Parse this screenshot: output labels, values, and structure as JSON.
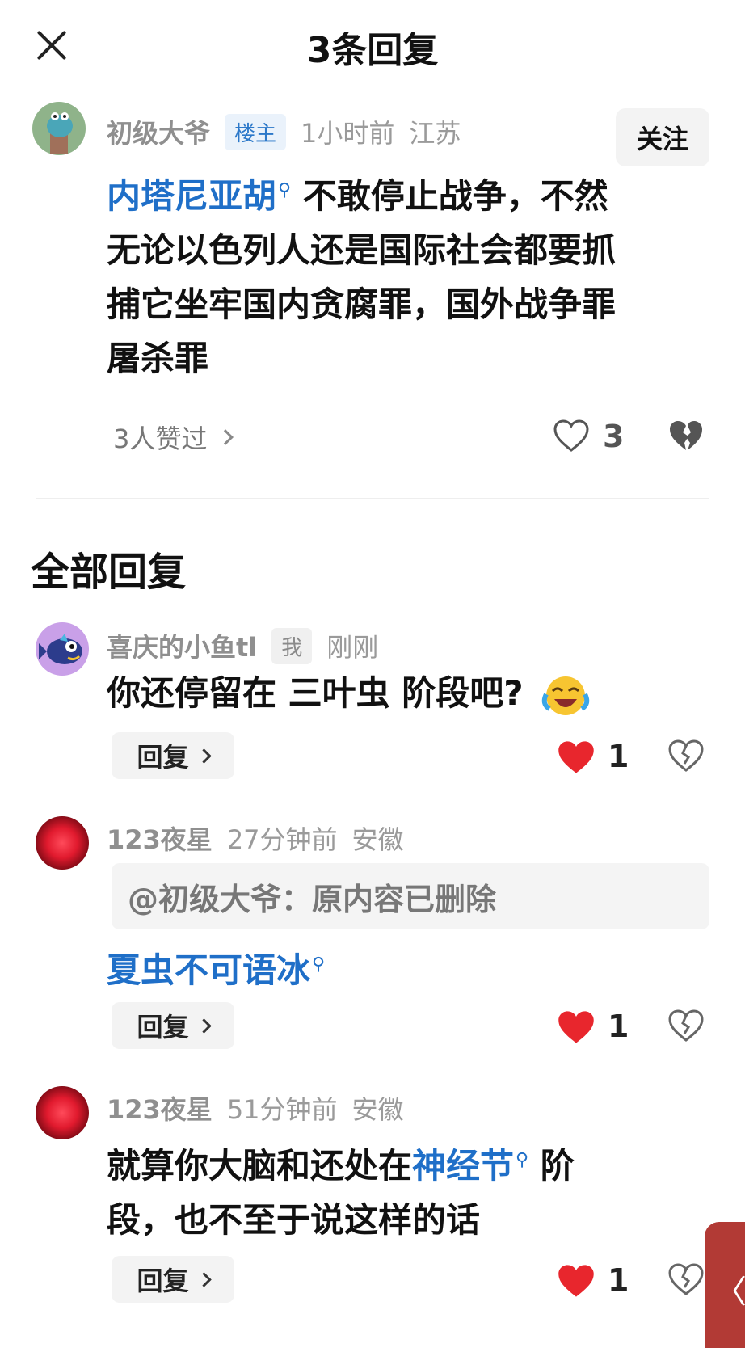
{
  "header": {
    "title": "3条回复"
  },
  "main_comment": {
    "username": "初级大爷",
    "badge": "楼主",
    "time": "1小时前",
    "location": "江苏",
    "follow_label": "关注",
    "link_text": "内塔尼亚胡",
    "text_line1_rest": "不敢停止战争，不然",
    "text_line2": "无论以色列人还是国际社会都要抓",
    "text_line3": "捕它坐牢国内贪腐罪，国外战争罪",
    "text_line4": "屠杀罪",
    "liked_by": "3人赞过",
    "like_count": "3"
  },
  "section_title": "全部回复",
  "replies": [
    {
      "username": "喜庆的小鱼tl",
      "badge": "我",
      "time": "刚刚",
      "text": "你还停留在 三叶虫 阶段吧?",
      "reply_label": "回复",
      "like_count": "1"
    },
    {
      "username": "123夜星",
      "time": "27分钟前",
      "location": "安徽",
      "quote": "@初级大爷：原内容已删除",
      "link_text": "夏虫不可语冰",
      "reply_label": "回复",
      "like_count": "1"
    },
    {
      "username": "123夜星",
      "time": "51分钟前",
      "location": "安徽",
      "text_prefix": "就算你大脑和还处在",
      "link_text": "神经节",
      "text_suffix": "阶",
      "text_line2": "段，也不至于说这样的话",
      "reply_label": "回复",
      "like_count": "1"
    }
  ],
  "side_tab_glyph": "〈",
  "colors": {
    "link": "#1f6fc8",
    "heart": "#e8262d",
    "side_tab": "#b23a35"
  }
}
